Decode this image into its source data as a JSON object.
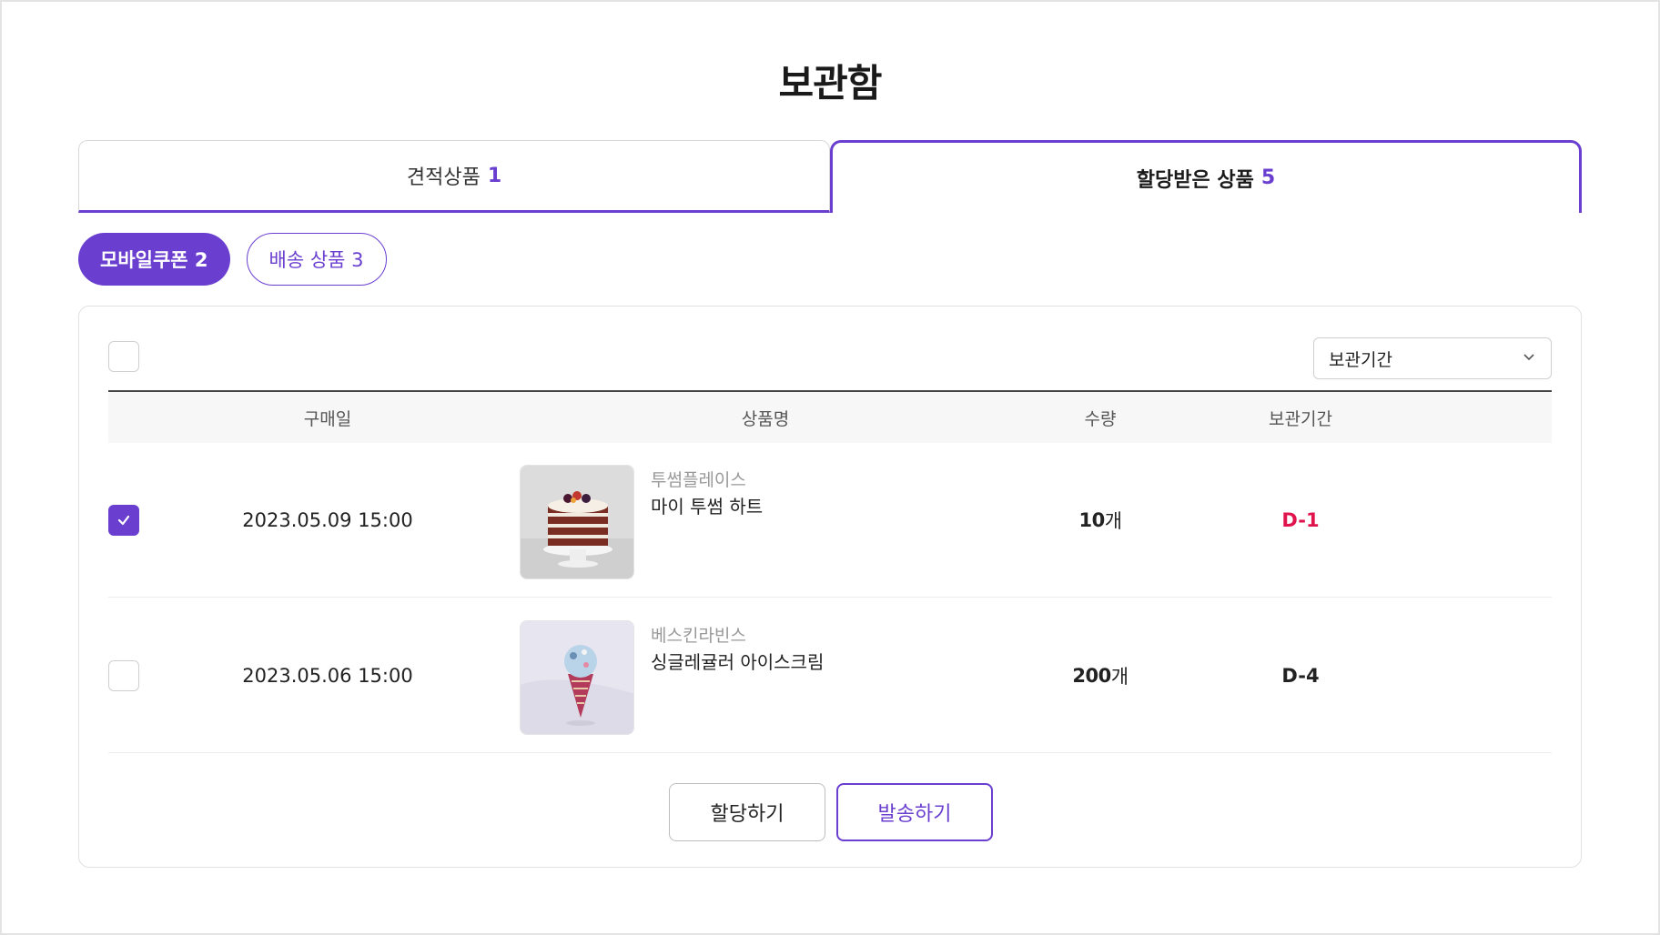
{
  "page": {
    "title": "보관함"
  },
  "tabs": [
    {
      "label": "견적상품",
      "count": "1",
      "active": false
    },
    {
      "label": "할당받은 상품",
      "count": "5",
      "active": true
    }
  ],
  "chips": [
    {
      "label": "모바일쿠폰 2",
      "active": true
    },
    {
      "label": "배송 상품 3",
      "active": false
    }
  ],
  "filter": {
    "sort_select": "보관기간"
  },
  "table": {
    "headers": {
      "date": "구매일",
      "product": "상품명",
      "qty": "수량",
      "period": "보관기간"
    },
    "rows": [
      {
        "checked": true,
        "date": "2023.05.09 15:00",
        "brand": "투썸플레이스",
        "name": "마이 투썸 하트",
        "qty": "10",
        "unit": "개",
        "period": "D-1",
        "period_color": "#e0144c",
        "image": "cake-image"
      },
      {
        "checked": false,
        "date": "2023.05.06 15:00",
        "brand": "베스킨라빈스",
        "name": "싱글레귤러 아이스크림",
        "qty": "200",
        "unit": "개",
        "period": "D-4",
        "period_color": "#222222",
        "image": "icecream-image"
      }
    ]
  },
  "actions": {
    "assign": "할당하기",
    "send": "발송하기"
  },
  "colors": {
    "accent": "#6a3fd0",
    "urgent": "#e0144c"
  }
}
